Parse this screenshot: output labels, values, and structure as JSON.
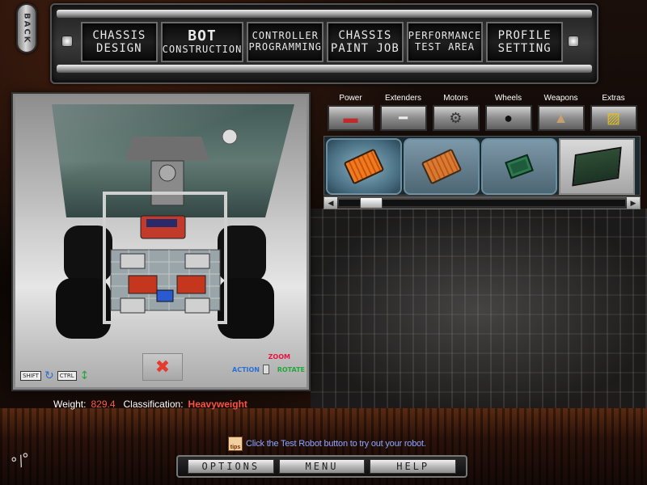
{
  "back_button": {
    "label": "BACK"
  },
  "nav": {
    "tabs": [
      {
        "line1": "CHASSIS",
        "line2": "DESIGN"
      },
      {
        "line1": "BOT",
        "line2": "CONSTRUCTION"
      },
      {
        "line1": "CONTROLLER",
        "line2": "PROGRAMMING"
      },
      {
        "line1": "CHASSIS",
        "line2": "PAINT JOB"
      },
      {
        "line1": "PERFORMANCE",
        "line2": "TEST AREA"
      },
      {
        "line1": "PROFILE",
        "line2": "SETTING"
      }
    ],
    "active_index": 1
  },
  "viewport": {
    "hud": {
      "shift_key": "SHIFT",
      "ctrl_key": "CTRL",
      "zoom_label": "ZOOM",
      "action_label": "ACTION",
      "rotate_label": "ROTATE"
    }
  },
  "stats": {
    "weight_label": "Weight:",
    "weight_value": "829.4",
    "classification_label": "Classification:",
    "classification_value": "Heavyweight"
  },
  "parts_panel": {
    "categories": [
      {
        "label": "Power",
        "icon": "battery-icon"
      },
      {
        "label": "Extenders",
        "icon": "extender-bar-icon"
      },
      {
        "label": "Motors",
        "icon": "motor-icon"
      },
      {
        "label": "Wheels",
        "icon": "wheel-icon"
      },
      {
        "label": "Weapons",
        "icon": "spike-icon"
      },
      {
        "label": "Extras",
        "icon": "hazard-plate-icon"
      }
    ],
    "items": [
      {
        "icon": "orange-controller-board-icon"
      },
      {
        "icon": "orange-controller-board-icon"
      },
      {
        "icon": "green-speed-controller-icon"
      },
      {
        "icon": "circuit-board-icon"
      }
    ],
    "scroll_position": 0.08
  },
  "tip": {
    "icon_label": "tips",
    "text": "Click the Test Robot button to try out your robot."
  },
  "bottom_menu": {
    "options_label": "OPTIONS",
    "menu_label": "MENU",
    "help_label": "HELP"
  },
  "colors": {
    "weight_value": "#ff5a4a",
    "classification": "#ff5040",
    "tip_text": "#8ba6ff",
    "zoom": "#e8133f",
    "action": "#2a6fd6",
    "rotate": "#23a83a"
  }
}
